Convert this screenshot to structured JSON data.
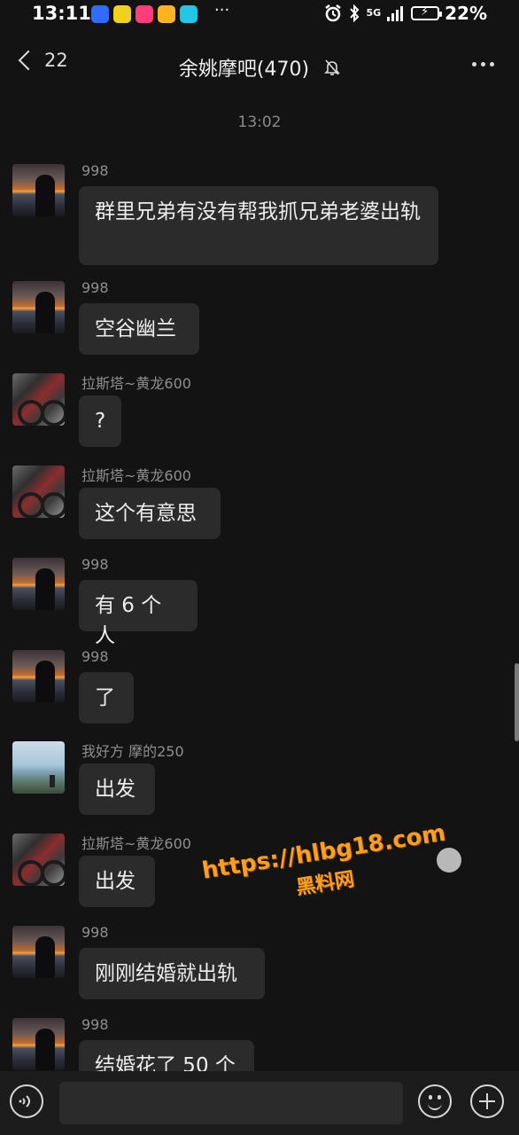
{
  "status": {
    "time": "13:11",
    "dots": "···",
    "network": "5G",
    "battery": "22%",
    "app_icons": [
      {
        "name": "baidu-app-icon",
        "color": "#2f6bff"
      },
      {
        "name": "duck-app-icon",
        "color": "#f2d11c"
      },
      {
        "name": "video-app-icon",
        "color": "#ff3d7a"
      },
      {
        "name": "emoji-app-icon",
        "color": "#ffb320"
      },
      {
        "name": "cyan-app-icon",
        "color": "#22c7e8"
      }
    ]
  },
  "header": {
    "back_count": "22",
    "title": "余姚摩吧(470)"
  },
  "timestamp": "13:02",
  "messages": [
    {
      "sender": "998",
      "text": "群里兄弟有没有帮我抓兄弟老婆出轨",
      "avatar": "sunset"
    },
    {
      "sender": "998",
      "text": "空谷幽兰",
      "avatar": "sunset"
    },
    {
      "sender": "拉斯塔~黄龙600",
      "text": "?",
      "avatar": "motorcycle"
    },
    {
      "sender": "拉斯塔~黄龙600",
      "text": "这个有意思",
      "avatar": "motorcycle"
    },
    {
      "sender": "998",
      "text": "有 6 个人",
      "avatar": "sunset"
    },
    {
      "sender": "998",
      "text": "了",
      "avatar": "sunset"
    },
    {
      "sender": "我好方 摩的250",
      "text": "出发",
      "avatar": "sea"
    },
    {
      "sender": "拉斯塔~黄龙600",
      "text": "出发",
      "avatar": "motorcycle"
    },
    {
      "sender": "998",
      "text": "刚刚结婚就出轨",
      "avatar": "sunset"
    },
    {
      "sender": "998",
      "text": "结婚花了 50 个",
      "avatar": "sunset"
    }
  ],
  "watermark": {
    "url": "https://hlbg18.com",
    "label": "黑料网",
    "color": "#ff9e1a"
  },
  "input": {
    "value": "",
    "placeholder": ""
  }
}
